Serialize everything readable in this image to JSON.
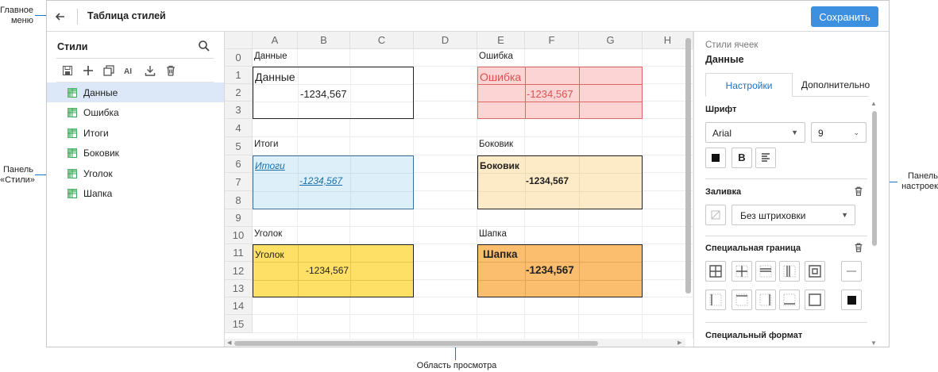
{
  "callouts": {
    "main_menu": [
      "Главное",
      "меню"
    ],
    "styles_panel": [
      "Панель",
      "«Стили»"
    ],
    "settings_panel": [
      "Панель",
      "настроек"
    ],
    "preview_area": "Область просмотра"
  },
  "header": {
    "title": "Таблица стилей",
    "save_label": "Сохранить"
  },
  "styles_panel": {
    "title": "Стили",
    "items": [
      {
        "label": "Данные",
        "selected": true
      },
      {
        "label": "Ошибка"
      },
      {
        "label": "Итоги"
      },
      {
        "label": "Боковик"
      },
      {
        "label": "Уголок"
      },
      {
        "label": "Шапка"
      }
    ]
  },
  "grid": {
    "columns": [
      "A",
      "B",
      "C",
      "D",
      "E",
      "F",
      "G",
      "H"
    ],
    "rows": [
      "0",
      "1",
      "2",
      "3",
      "4",
      "5",
      "6",
      "7",
      "8",
      "9",
      "10",
      "11",
      "12",
      "13",
      "14",
      "15"
    ],
    "blocks": {
      "data": {
        "caption": "Данные",
        "label": "Данные",
        "value": "-1234,567"
      },
      "error": {
        "caption": "Ошибка",
        "label": "Ошибка",
        "value": "-1234,567"
      },
      "totals": {
        "caption": "Итоги",
        "label": "Итоги",
        "value": "-1234,567"
      },
      "side": {
        "caption": "Боковик",
        "label": "Боковик",
        "value": "-1234,567"
      },
      "corner": {
        "caption": "Уголок",
        "label": "Уголок",
        "value": "-1234,567"
      },
      "header": {
        "caption": "Шапка",
        "label": "Шапка",
        "value": "-1234,567"
      }
    },
    "colors": {
      "error_fill": "#fcd4d4",
      "error_border": "#e06666",
      "error_text": "#e05050",
      "totals_fill": "#ddf0f9",
      "totals_border": "#3a6f9c",
      "totals_text": "#1a6fa8",
      "side_fill": "#fdebc8",
      "corner_fill": "#ffe066",
      "header_fill": "#fbbd6e"
    }
  },
  "settings_panel": {
    "subtitle": "Стили ячеек",
    "title": "Данные",
    "tabs": [
      "Настройки",
      "Дополнительно"
    ],
    "font_section": "Шрифт",
    "font_family": "Arial",
    "font_size": "9",
    "fill_section": "Заливка",
    "fill_pattern": "Без штриховки",
    "border_section": "Специальная граница",
    "format_section": "Специальный формат"
  }
}
